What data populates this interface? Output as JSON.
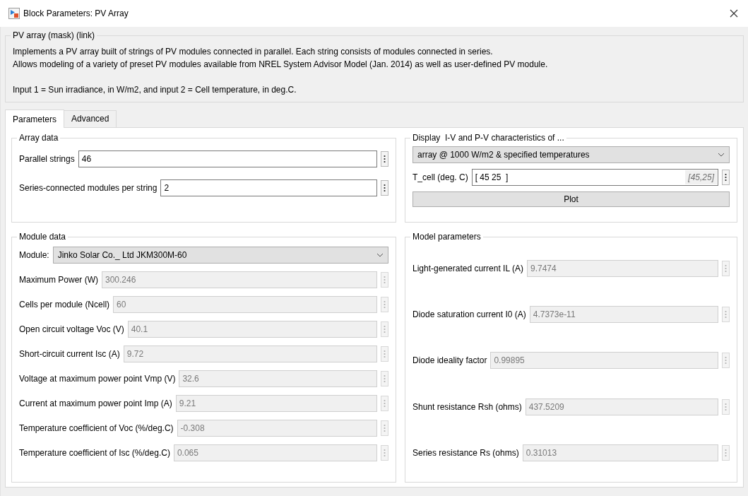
{
  "window": {
    "title": "Block Parameters: PV Array"
  },
  "description": {
    "heading": "PV array (mask) (link)",
    "paragraphs": [
      "Implements a PV array built of strings of PV modules connected in parallel. Each string consists of modules connected in series.\nAllows modeling of a variety of preset PV modules available from NREL System Advisor Model (Jan. 2014) as well as user-defined PV module.",
      "Input 1 = Sun irradiance, in W/m2, and input 2 = Cell temperature, in deg.C."
    ]
  },
  "tabs": [
    {
      "label": "Parameters",
      "selected": true
    },
    {
      "label": "Advanced",
      "selected": false
    }
  ],
  "array_data": {
    "title": "Array data",
    "fields": [
      {
        "label": "Parallel strings",
        "value": "46",
        "disabled": false
      },
      {
        "label": "Series-connected modules per string",
        "value": "2",
        "disabled": false
      }
    ]
  },
  "display": {
    "title": "Display  I-V and P-V characteristics of ...",
    "dropdown": "array @ 1000 W/m2 & specified temperatures",
    "field": {
      "label": "T_cell (deg. C)",
      "value": "[ 45 25  ]",
      "evaluated": "[45,25]",
      "disabled": false
    },
    "button": "Plot"
  },
  "module_data": {
    "title": "Module data",
    "module": {
      "label": "Module:",
      "value": "Jinko Solar Co._ Ltd JKM300M-60"
    },
    "fields": [
      {
        "label": "Maximum Power (W)",
        "value": "300.246",
        "disabled": true
      },
      {
        "label": "Cells per module (Ncell)",
        "value": "60",
        "disabled": true
      },
      {
        "label": "Open circuit voltage  Voc (V)",
        "value": "40.1",
        "disabled": true
      },
      {
        "label": "Short-circuit current Isc (A)",
        "value": "9.72",
        "disabled": true
      },
      {
        "label": "Voltage at maximum power point Vmp (V)",
        "value": "32.6",
        "disabled": true
      },
      {
        "label": "Current at maximum power point Imp (A)",
        "value": "9.21",
        "disabled": true
      },
      {
        "label": "Temperature coefficient of Voc (%/deg.C)",
        "value": "-0.308",
        "disabled": true
      },
      {
        "label": "Temperature coefficient of Isc (%/deg.C)",
        "value": "0.065",
        "disabled": true
      }
    ]
  },
  "model_parameters": {
    "title": "Model parameters",
    "fields": [
      {
        "label": "Light-generated current IL (A)",
        "value": "9.7474",
        "disabled": true
      },
      {
        "label": "Diode saturation current I0 (A)",
        "value": "4.7373e-11",
        "disabled": true
      },
      {
        "label": "Diode ideality factor",
        "value": "0.99895",
        "disabled": true
      },
      {
        "label": "Shunt resistance Rsh (ohms)",
        "value": "437.5209",
        "disabled": true
      },
      {
        "label": "Series resistance Rs (ohms)",
        "value": "0.31013",
        "disabled": true
      }
    ]
  }
}
